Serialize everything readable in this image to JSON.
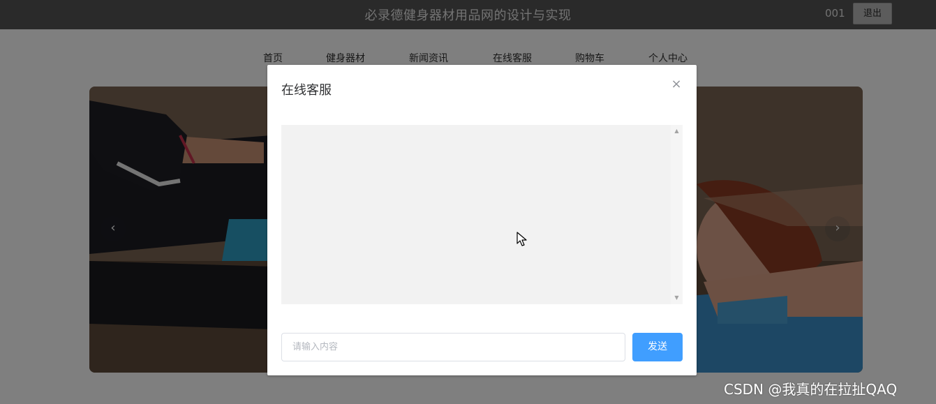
{
  "header": {
    "title": "必录德健身器材用品网的设计与实现",
    "username": "001",
    "logout_label": "退出"
  },
  "nav": {
    "items": [
      {
        "label": "首页"
      },
      {
        "label": "健身器材"
      },
      {
        "label": "新闻资讯"
      },
      {
        "label": "在线客服"
      },
      {
        "label": "购物车"
      },
      {
        "label": "个人中心"
      }
    ]
  },
  "carousel": {
    "prev_icon": "chevron-left-icon",
    "next_icon": "chevron-right-icon",
    "prev_glyph": "‹",
    "next_glyph": "›"
  },
  "dialog": {
    "title": "在线客服",
    "close_glyph": "×",
    "input_placeholder": "请输入内容",
    "send_label": "发送",
    "scroll_up_glyph": "▲",
    "scroll_down_glyph": "▼"
  },
  "watermark": "CSDN @我真的在拉扯QAQ",
  "colors": {
    "header_bg": "#545454",
    "primary": "#409eff",
    "overlay": "rgba(0,0,0,0.5)"
  }
}
